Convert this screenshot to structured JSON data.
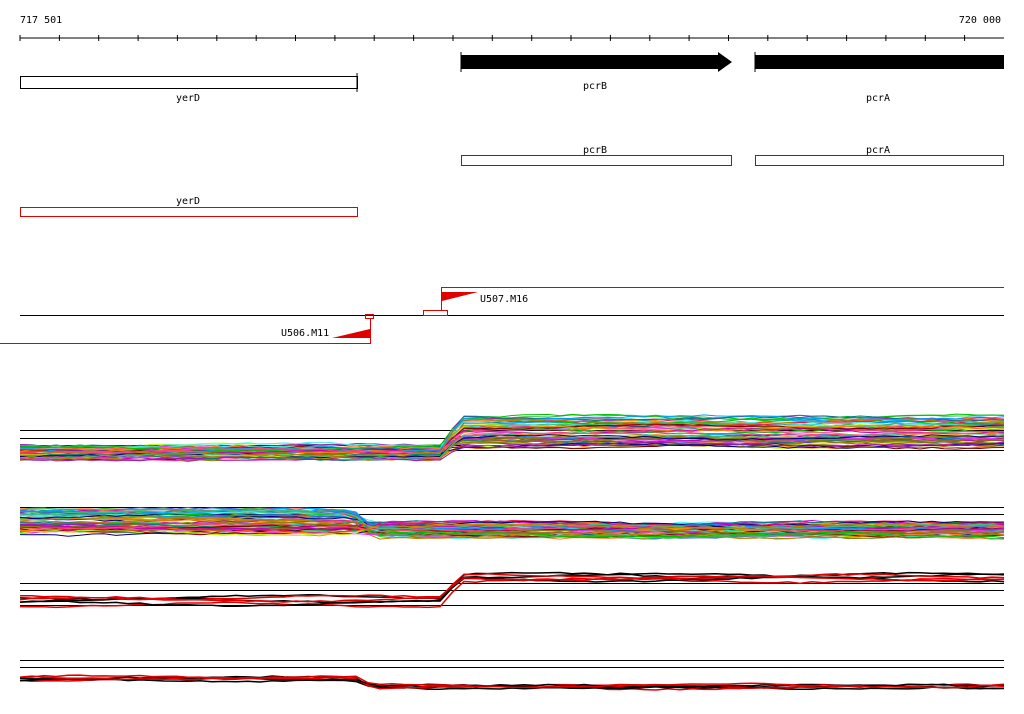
{
  "axis": {
    "start_label": "717 501",
    "end_label": "720 000",
    "start": 717501,
    "end": 720000
  },
  "genes": {
    "yerD": {
      "label": "yerD",
      "strand": "-"
    },
    "pcrB": {
      "label": "pcrB",
      "strand": "+"
    },
    "pcrA": {
      "label": "pcrA",
      "strand": "+"
    }
  },
  "annotation_track_1": {
    "yerD": "yerD",
    "pcrB": "pcrB",
    "pcrA": "pcrA"
  },
  "annotation_track_2": {
    "yerD": "yerD"
  },
  "transcription_units": {
    "upper": {
      "label": "U507.M16",
      "direction": "right"
    },
    "lower": {
      "label": "U506.M11",
      "direction": "left"
    }
  },
  "colors": {
    "black": "#000000",
    "blue": "#1f2fbf",
    "red": "#e00000",
    "grid": "#000000"
  },
  "expression_series_palette": [
    "#e6194b",
    "#3cb44b",
    "#4363d8",
    "#f58231",
    "#911eb4",
    "#46f0f0",
    "#f032e6",
    "#bcf60c",
    "#008080",
    "#9a6324",
    "#800000",
    "#808000",
    "#000075",
    "#ff7f00",
    "#00c000",
    "#c000c0",
    "#00a0ff",
    "#ff4080",
    "#40c080",
    "#c08000"
  ]
}
